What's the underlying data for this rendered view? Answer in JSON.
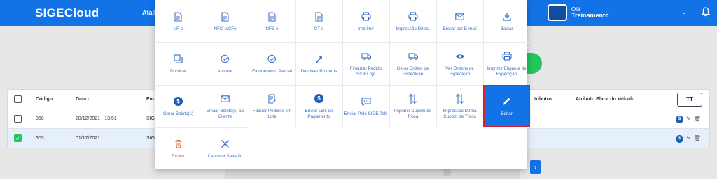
{
  "header": {
    "logo_text": "SIGE",
    "logo_suffix": "Cloud",
    "nav_partial": "Atalh",
    "greeting": "Olá",
    "user_name": "Treinamento"
  },
  "table": {
    "columns": [
      "Código",
      "Data ↑",
      "Em",
      "tributos",
      "Atributo Placa do Veículo"
    ],
    "config_label": "TT",
    "rows": [
      {
        "code": "358",
        "date": "28/12/2021 - 13:51",
        "partial": "SIG"
      },
      {
        "code": "303",
        "date": "01/12/2021",
        "partial": "SIG"
      }
    ],
    "checked_glyph": "✓"
  },
  "actions": [
    {
      "label": "NF-e",
      "icon": "document-icon"
    },
    {
      "label": "NFC-e/CFe",
      "icon": "document-icon"
    },
    {
      "label": "NFS-e",
      "icon": "document-icon"
    },
    {
      "label": "CT-e",
      "icon": "document-icon"
    },
    {
      "label": "Imprimir",
      "icon": "printer-icon"
    },
    {
      "label": "Impressão Direta",
      "icon": "printer-icon"
    },
    {
      "label": "Enviar por E-mail",
      "icon": "mail-icon"
    },
    {
      "label": "Baixar",
      "icon": "download-icon"
    },
    {
      "label": "Duplicar",
      "icon": "duplicate-icon"
    },
    {
      "label": "Aprovar",
      "icon": "check-icon"
    },
    {
      "label": "Faturamento Parcial",
      "icon": "check-icon"
    },
    {
      "label": "Devolver Produtos",
      "icon": "return-icon"
    },
    {
      "label": "Finalizar Pedido SIGELoja",
      "icon": "truck-icon"
    },
    {
      "label": "Gerar Ordem de Expedição",
      "icon": "truck-icon"
    },
    {
      "label": "Ver Ordens de Expedição",
      "icon": "eye-icon"
    },
    {
      "label": "Imprimir Etiqueta de Expedição",
      "icon": "printer-icon"
    },
    {
      "label": "Gerar Boleto(s)",
      "icon": "money-icon"
    },
    {
      "label": "Enviar Boleto(s) ao Cliente",
      "icon": "mail-icon"
    },
    {
      "label": "Faturar Pedidos em Lote",
      "icon": "batch-invoice-icon"
    },
    {
      "label": "Enviar Link de Pagamento",
      "icon": "money-icon"
    },
    {
      "label": "Enviar Pelo SIGE Talk",
      "icon": "chat-icon"
    },
    {
      "label": "Imprimir Cupom de Troca",
      "icon": "swap-arrows-icon"
    },
    {
      "label": "Impressão Direta Cupom de Troca",
      "icon": "swap-arrows-icon"
    },
    {
      "label": "Editar",
      "icon": "pencil-icon"
    },
    {
      "label": "Excluir",
      "icon": "trash-icon"
    },
    {
      "label": "Cancelar Seleção",
      "icon": "close-icon"
    }
  ],
  "glyphs": {
    "money": "$",
    "edit": "✎",
    "trash": "🗑",
    "chevron_down": "⌄",
    "page_next": "›"
  },
  "colors": {
    "primary": "#1273e6",
    "action_text": "#3b6fc4",
    "destructive": "#e2632b",
    "highlight_border": "#d9202a",
    "success": "#22c55e"
  }
}
